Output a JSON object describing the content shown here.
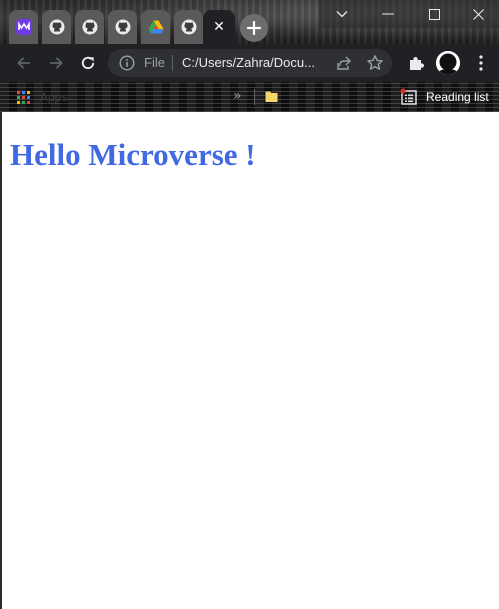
{
  "browser": {
    "tabs": [
      {
        "icon": "microverse-icon"
      },
      {
        "icon": "github-icon"
      },
      {
        "icon": "github-icon"
      },
      {
        "icon": "github-icon"
      },
      {
        "icon": "google-drive-icon"
      },
      {
        "icon": "github-icon"
      },
      {
        "icon": "close-icon",
        "active": true
      }
    ],
    "new_tab_icon": "plus-icon",
    "window_controls": [
      "chevron-down-icon",
      "minimize-icon",
      "maximize-icon",
      "close-icon"
    ],
    "toolbar": {
      "back_icon": "back-arrow-icon",
      "forward_icon": "forward-arrow-icon",
      "reload_icon": "reload-icon",
      "omnibox": {
        "scheme_label": "File",
        "url": "C:/Users/Zahra/Docu..."
      }
    },
    "bookmarks": {
      "apps_label": "Apps",
      "overflow_label": "»",
      "reading_list_label": "Reading list"
    },
    "colors": {
      "tab_active": "#202124",
      "heading": "#4169e1",
      "microverse_accent": "#6d3ce5"
    }
  },
  "page": {
    "heading": "Hello Microverse !"
  }
}
